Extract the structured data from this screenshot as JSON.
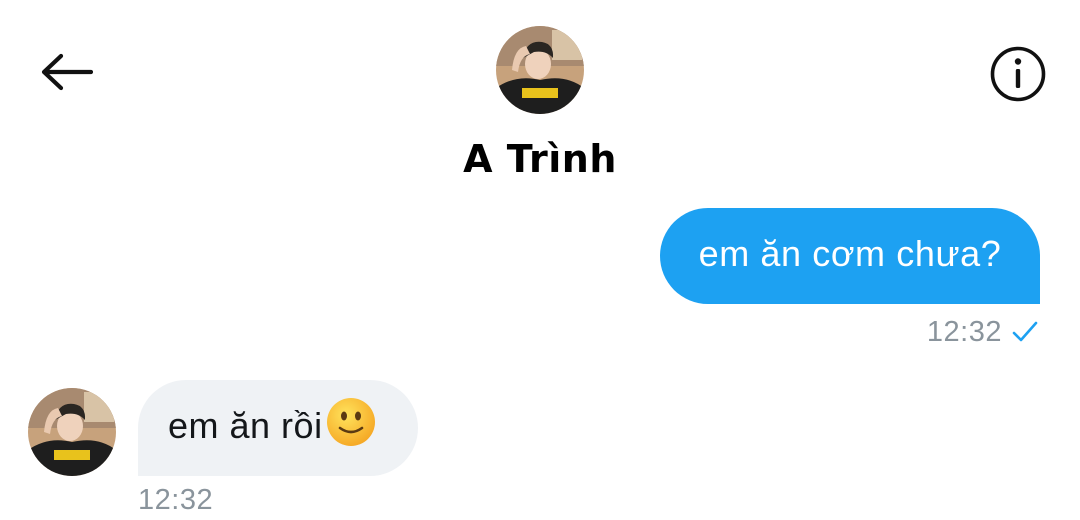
{
  "header": {
    "back_icon": "arrow-left-icon",
    "info_icon": "info-circle-icon",
    "contact_name": "A Trình"
  },
  "messages": [
    {
      "direction": "outgoing",
      "text": "em ăn cơm chưa?",
      "time": "12:32",
      "status_icon": "checkmark-icon"
    },
    {
      "direction": "incoming",
      "text": "em ăn rồi",
      "emoji_icon": "slightly-smiling-face-icon",
      "time": "12:32"
    }
  ],
  "colors": {
    "outgoing_bubble": "#1da1f2",
    "incoming_bubble": "#eff2f5",
    "timestamp": "#8a949c",
    "check": "#1da1f2"
  }
}
